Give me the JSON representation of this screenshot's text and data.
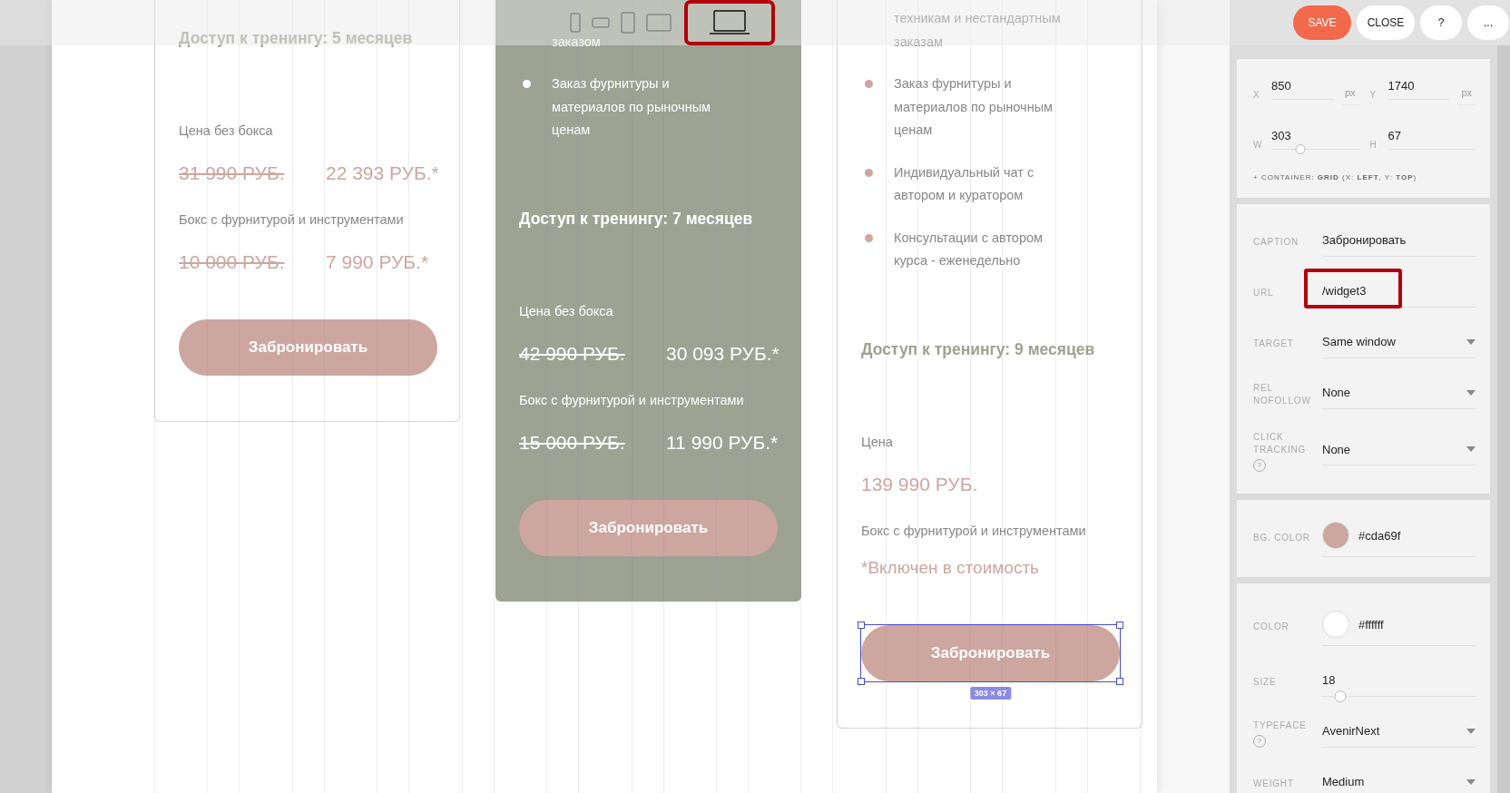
{
  "toolbar": {
    "devices": [
      {
        "kind": "phone",
        "selected": false
      },
      {
        "kind": "phone-landscape",
        "selected": false
      },
      {
        "kind": "tablet",
        "selected": false
      },
      {
        "kind": "tablet-landscape",
        "selected": false
      },
      {
        "kind": "laptop",
        "selected": true
      }
    ]
  },
  "actions": [
    {
      "label": "SAVE",
      "primary": true
    },
    {
      "label": "CLOSE",
      "primary": false
    },
    {
      "label": "?",
      "primary": false
    },
    {
      "label": "...",
      "primary": false
    }
  ],
  "cards": [
    {
      "highlighted": false,
      "items": [
        {
          "kind": "heading",
          "text": "Доступ к тренингу: 5 месяцев"
        },
        {
          "kind": "label",
          "text": "Цена без бокса"
        },
        {
          "kind": "prices",
          "old": "31 990 РУБ.",
          "new": "22 393 РУБ.*"
        },
        {
          "kind": "label",
          "text": "Бокс с фурнитурой и инструментами"
        },
        {
          "kind": "prices",
          "old": "10 000 РУБ.",
          "new": "7 990 РУБ.*"
        },
        {
          "kind": "button",
          "text": "Забронировать",
          "selected": false
        }
      ]
    },
    {
      "highlighted": true,
      "items": [
        {
          "kind": "bullet",
          "marker": false,
          "text": "заказом"
        },
        {
          "kind": "bullet",
          "marker": true,
          "text": "Заказ фурнитуры и материалов по рыночным ценам"
        },
        {
          "kind": "heading",
          "text": "Доступ к тренингу: 7 месяцев"
        },
        {
          "kind": "label",
          "text": "Цена без бокса"
        },
        {
          "kind": "prices",
          "old": "42 990 РУБ.",
          "new": "30 093 РУБ.*"
        },
        {
          "kind": "label",
          "text": "Бокс с фурнитурой и инструментами"
        },
        {
          "kind": "prices",
          "old": "15 000 РУБ.",
          "new": "11 990 РУБ.*"
        },
        {
          "kind": "button",
          "text": "Забронировать",
          "selected": false
        }
      ]
    },
    {
      "highlighted": false,
      "items": [
        {
          "kind": "bullet",
          "marker": false,
          "text": "техникам и нестандартным заказам"
        },
        {
          "kind": "bullet",
          "marker": true,
          "text": "Заказ фурнитуры и материалов по рыночным ценам"
        },
        {
          "kind": "bullet",
          "marker": true,
          "text": "Индивидуальный чат с автором и куратором"
        },
        {
          "kind": "bullet",
          "marker": true,
          "text": "Консультации с автором курса - еженедельно"
        },
        {
          "kind": "heading",
          "text": "Доступ к тренингу: 9 месяцев"
        },
        {
          "kind": "label",
          "text": "Цена"
        },
        {
          "kind": "price",
          "text": "139 990 РУБ."
        },
        {
          "kind": "label",
          "text": "Бокс с фурнитурой и инструментами"
        },
        {
          "kind": "note",
          "text": "*Включен в стоимость"
        },
        {
          "kind": "button",
          "text": "Забронировать",
          "selected": true
        }
      ]
    }
  ],
  "selection": {
    "size": "303 × 67"
  },
  "panel": {
    "geometry": {
      "fields": [
        {
          "label": "X",
          "value": "850",
          "unit": "px"
        },
        {
          "label": "Y",
          "value": "1740",
          "unit": "px"
        },
        {
          "label": "W",
          "value": "303",
          "level": 0.33
        },
        {
          "label": "H",
          "value": "67"
        }
      ],
      "note": "+ CONTAINER: **GRID** (X: **LEFT**, Y: **TOP**)"
    },
    "sections": [
      {
        "fields": [
          {
            "kind": "text",
            "label": "CAPTION",
            "value": "Забронировать"
          },
          {
            "kind": "text",
            "label": "URL",
            "value": "/widget3",
            "highlighted": true
          },
          {
            "kind": "select",
            "label": "TARGET",
            "value": "Same window"
          },
          {
            "kind": "select",
            "label": "REL NOFOLLOW",
            "value": "None"
          },
          {
            "kind": "select",
            "label": "CLICK TRACKING",
            "help": "?",
            "value": "None"
          }
        ]
      },
      {
        "fields": [
          {
            "kind": "color",
            "label": "BG. COLOR",
            "value": "#cda69f"
          }
        ]
      },
      {
        "fields": [
          {
            "kind": "color",
            "label": "COLOR",
            "value": "#ffffff"
          },
          {
            "kind": "slider",
            "label": "SIZE",
            "value": "18",
            "level": 0.12
          },
          {
            "kind": "select",
            "label": "TYPEFACE",
            "help": "?",
            "value": "AvenirNext"
          },
          {
            "kind": "select",
            "label": "WEIGHT",
            "value": "Medium"
          }
        ]
      }
    ]
  }
}
